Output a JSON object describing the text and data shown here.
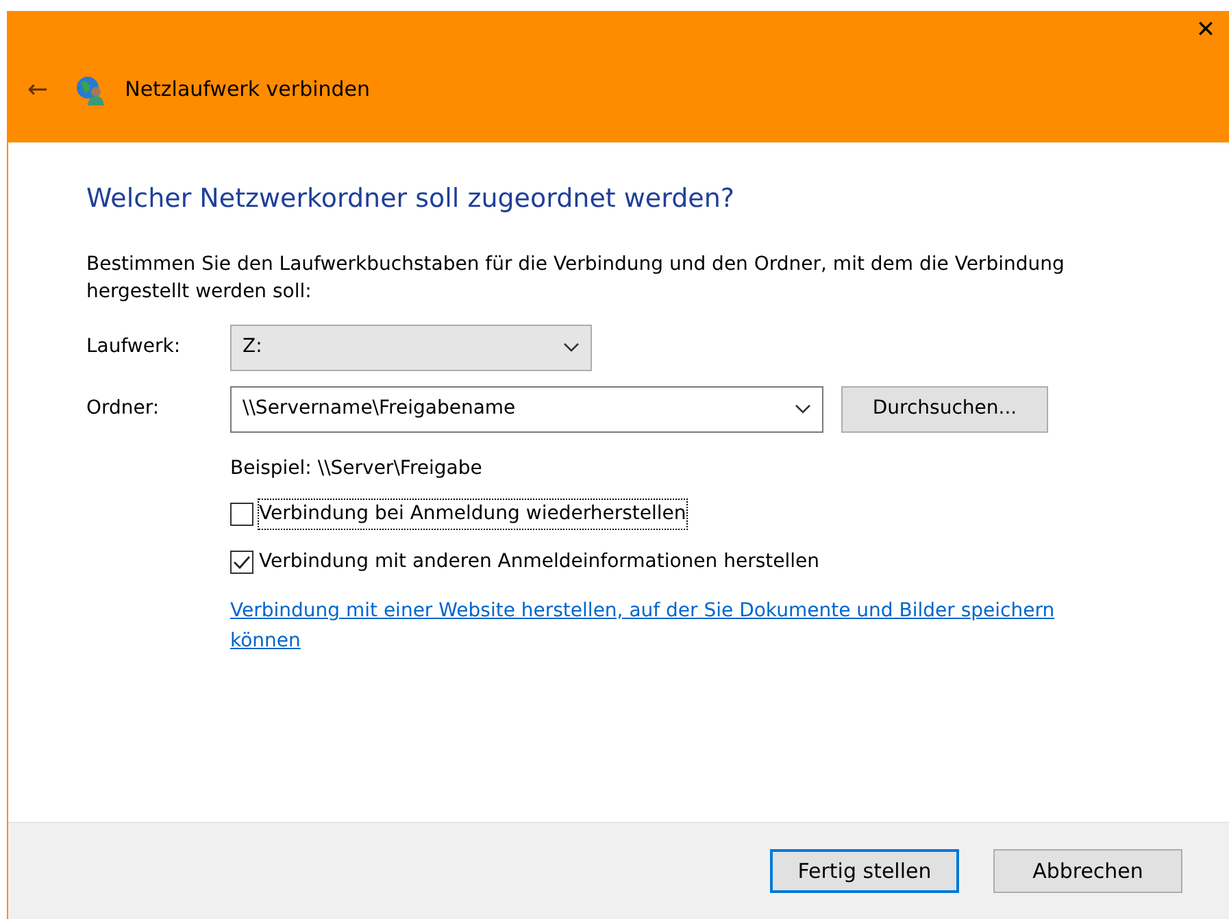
{
  "window": {
    "title": "Netzlaufwerk verbinden",
    "close": "✕",
    "back": "←"
  },
  "heading": "Welcher Netzwerkordner soll zugeordnet werden?",
  "instruction": "Bestimmen Sie den Laufwerkbuchstaben für die Verbindung und den Ordner, mit dem die Verbindung hergestellt werden soll:",
  "drive": {
    "label": "Laufwerk:",
    "value": "Z:"
  },
  "folder": {
    "label": "Ordner:",
    "value": "\\\\Servername\\Freigabename",
    "browse": "Durchsuchen..."
  },
  "example": "Beispiel: \\\\Server\\Freigabe",
  "options": [
    {
      "label": "Verbindung bei Anmeldung wiederherstellen",
      "checked": false,
      "focused": true
    },
    {
      "label": "Verbindung mit anderen Anmeldeinformationen herstellen",
      "checked": true,
      "focused": false
    }
  ],
  "link": "Verbindung mit einer Website herstellen, auf der Sie Dokumente und Bilder speichern können",
  "buttons": [
    {
      "label": "Fertig stellen",
      "default": true
    },
    {
      "label": "Abbrechen",
      "default": false
    }
  ]
}
